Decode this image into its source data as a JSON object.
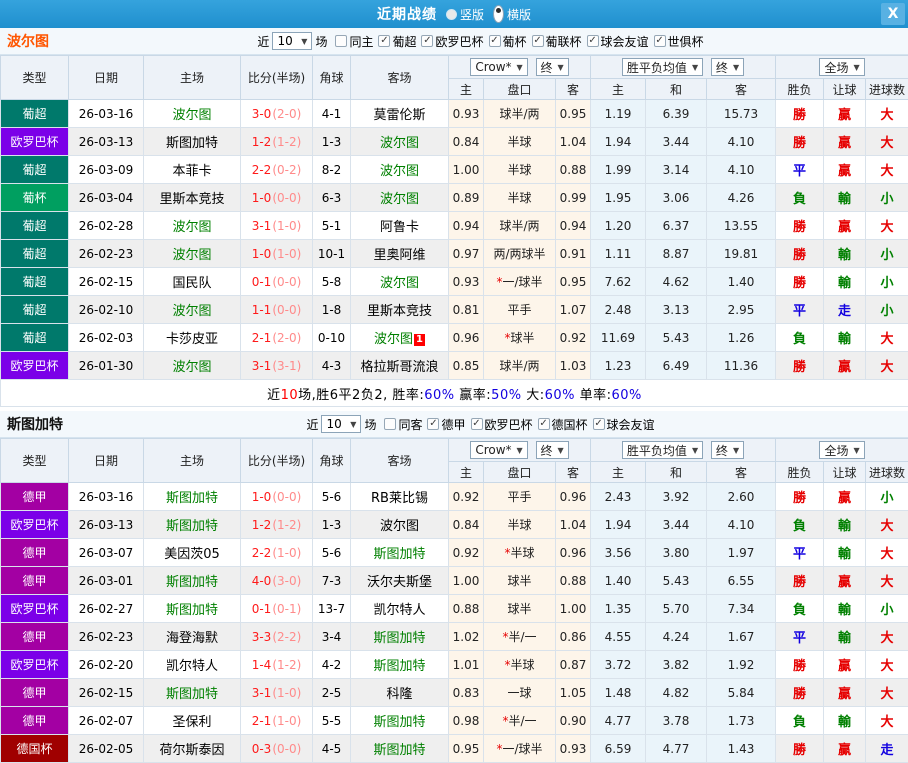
{
  "titlebar": {
    "title": "近期战绩",
    "radios": [
      {
        "label": "竖版",
        "selected": false
      },
      {
        "label": "横版",
        "selected": true
      }
    ],
    "close_label": "X"
  },
  "icons": {
    "dropdown_arrow": "▼",
    "check": "✓"
  },
  "filter_labels": {
    "near": "近",
    "games_suffix": "场"
  },
  "header": {
    "cols": [
      "类型",
      "日期",
      "主场",
      "比分(半场)",
      "角球",
      "客场"
    ],
    "odds_select": "Crow*",
    "final_select": "终",
    "avg_select": "胜平负均值",
    "avg_final_select": "终",
    "scope_select": "全场",
    "odds_sub": [
      "主",
      "盘口",
      "客"
    ],
    "avg_sub": [
      "主",
      "和",
      "客"
    ],
    "result_sub": [
      "胜负",
      "让球",
      "进球数"
    ]
  },
  "type_colors": {
    "葡超": "#00796B",
    "欧罗巴杯": "#7B00E8",
    "葡杯": "#009F60",
    "德甲": "#A300A3",
    "德国杯": "#A00000"
  },
  "result_colors": {
    "勝": "r",
    "贏": "r",
    "大": "r",
    "平": "b",
    "走": "b",
    "負": "g",
    "輸": "g",
    "小": "g"
  },
  "accent_colors": {
    "titlebar_blue": "#2E9AD5",
    "tracked_team_green": "#008000",
    "score_red": "#FF1A1A",
    "half_score_pink": "#FF8A8A",
    "odds_bg_cream": "#FDF5EA",
    "avg_bg_blue": "#EAF4FA"
  },
  "sections": [
    {
      "team": "波尔图",
      "team_color": "#FF5500",
      "filter": {
        "count": "10",
        "same_label": "同主",
        "same_checked": false,
        "leagues": [
          "葡超",
          "欧罗巴杯",
          "葡杯",
          "葡联杯",
          "球会友谊",
          "世俱杯"
        ]
      },
      "rows": [
        {
          "type": "葡超",
          "date": "26-03-16",
          "home": "波尔图",
          "score": "3-0",
          "half": "(2-0)",
          "corner": "4-1",
          "away": "莫雷伦斯",
          "oh": "0.93",
          "star": "",
          "handicap": "球半/两",
          "oa": "0.95",
          "ah": "1.19",
          "ad": "6.39",
          "aa": "15.73",
          "r1": "勝",
          "r2": "贏",
          "r3": "大"
        },
        {
          "type": "欧罗巴杯",
          "date": "26-03-13",
          "home": "斯图加特",
          "score": "1-2",
          "half": "(1-2)",
          "corner": "1-3",
          "away": "波尔图",
          "oh": "0.84",
          "star": "",
          "handicap": "半球",
          "oa": "1.04",
          "ah": "1.94",
          "ad": "3.44",
          "aa": "4.10",
          "r1": "勝",
          "r2": "贏",
          "r3": "大"
        },
        {
          "type": "葡超",
          "date": "26-03-09",
          "home": "本菲卡",
          "score": "2-2",
          "half": "(0-2)",
          "corner": "8-2",
          "away": "波尔图",
          "oh": "1.00",
          "star": "",
          "handicap": "半球",
          "oa": "0.88",
          "ah": "1.99",
          "ad": "3.14",
          "aa": "4.10",
          "r1": "平",
          "r2": "贏",
          "r3": "大"
        },
        {
          "type": "葡杯",
          "date": "26-03-04",
          "home": "里斯本竞技",
          "score": "1-0",
          "half": "(0-0)",
          "corner": "6-3",
          "away": "波尔图",
          "oh": "0.89",
          "star": "",
          "handicap": "半球",
          "oa": "0.99",
          "ah": "1.95",
          "ad": "3.06",
          "aa": "4.26",
          "r1": "負",
          "r2": "輸",
          "r3": "小"
        },
        {
          "type": "葡超",
          "date": "26-02-28",
          "home": "波尔图",
          "score": "3-1",
          "half": "(1-0)",
          "corner": "5-1",
          "away": "阿鲁卡",
          "oh": "0.94",
          "star": "",
          "handicap": "球半/两",
          "oa": "0.94",
          "ah": "1.20",
          "ad": "6.37",
          "aa": "13.55",
          "r1": "勝",
          "r2": "贏",
          "r3": "大"
        },
        {
          "type": "葡超",
          "date": "26-02-23",
          "home": "波尔图",
          "score": "1-0",
          "half": "(1-0)",
          "corner": "10-1",
          "away": "里奥阿维",
          "oh": "0.97",
          "star": "",
          "handicap": "两/两球半",
          "oa": "0.91",
          "ah": "1.11",
          "ad": "8.87",
          "aa": "19.81",
          "r1": "勝",
          "r2": "輸",
          "r3": "小"
        },
        {
          "type": "葡超",
          "date": "26-02-15",
          "home": "国民队",
          "score": "0-1",
          "half": "(0-0)",
          "corner": "5-8",
          "away": "波尔图",
          "oh": "0.93",
          "star": "*",
          "handicap": "一/球半",
          "oa": "0.95",
          "ah": "7.62",
          "ad": "4.62",
          "aa": "1.40",
          "r1": "勝",
          "r2": "輸",
          "r3": "小"
        },
        {
          "type": "葡超",
          "date": "26-02-10",
          "home": "波尔图",
          "score": "1-1",
          "half": "(0-0)",
          "corner": "1-8",
          "away": "里斯本竞技",
          "oh": "0.81",
          "star": "",
          "handicap": "平手",
          "oa": "1.07",
          "ah": "2.48",
          "ad": "3.13",
          "aa": "2.95",
          "r1": "平",
          "r2": "走",
          "r3": "小"
        },
        {
          "type": "葡超",
          "date": "26-02-03",
          "home": "卡莎皮亚",
          "score": "2-1",
          "half": "(2-0)",
          "corner": "0-10",
          "away": "波尔图",
          "away_badge": "1",
          "oh": "0.96",
          "star": "*",
          "handicap": "球半",
          "oa": "0.92",
          "ah": "11.69",
          "ad": "5.43",
          "aa": "1.26",
          "r1": "負",
          "r2": "輸",
          "r3": "大"
        },
        {
          "type": "欧罗巴杯",
          "date": "26-01-30",
          "home": "波尔图",
          "score": "3-1",
          "half": "(3-1)",
          "corner": "4-3",
          "away": "格拉斯哥流浪",
          "oh": "0.85",
          "star": "",
          "handicap": "球半/两",
          "oa": "1.03",
          "ah": "1.23",
          "ad": "6.49",
          "aa": "11.36",
          "r1": "勝",
          "r2": "贏",
          "r3": "大"
        }
      ],
      "summary": [
        {
          "t": "近"
        },
        {
          "t": "10",
          "c": "r"
        },
        {
          "t": "场,胜6平2负2, 胜率:"
        },
        {
          "t": "60%",
          "c": "b"
        },
        {
          "t": " 赢率:"
        },
        {
          "t": "50%",
          "c": "b"
        },
        {
          "t": " 大:"
        },
        {
          "t": "60%",
          "c": "b"
        },
        {
          "t": " 单率:"
        },
        {
          "t": "60%",
          "c": "b"
        }
      ]
    },
    {
      "team": "斯图加特",
      "team_color": "#111111",
      "filter": {
        "count": "10",
        "same_label": "同客",
        "same_checked": false,
        "leagues": [
          "德甲",
          "欧罗巴杯",
          "德国杯",
          "球会友谊"
        ]
      },
      "rows": [
        {
          "type": "德甲",
          "date": "26-03-16",
          "home": "斯图加特",
          "score": "1-0",
          "half": "(0-0)",
          "corner": "5-6",
          "away": "RB莱比锡",
          "oh": "0.92",
          "star": "",
          "handicap": "平手",
          "oa": "0.96",
          "ah": "2.43",
          "ad": "3.92",
          "aa": "2.60",
          "r1": "勝",
          "r2": "贏",
          "r3": "小"
        },
        {
          "type": "欧罗巴杯",
          "date": "26-03-13",
          "home": "斯图加特",
          "score": "1-2",
          "half": "(1-2)",
          "corner": "1-3",
          "away": "波尔图",
          "oh": "0.84",
          "star": "",
          "handicap": "半球",
          "oa": "1.04",
          "ah": "1.94",
          "ad": "3.44",
          "aa": "4.10",
          "r1": "負",
          "r2": "輸",
          "r3": "大"
        },
        {
          "type": "德甲",
          "date": "26-03-07",
          "home": "美因茨05",
          "score": "2-2",
          "half": "(1-0)",
          "corner": "5-6",
          "away": "斯图加特",
          "oh": "0.92",
          "star": "*",
          "handicap": "半球",
          "oa": "0.96",
          "ah": "3.56",
          "ad": "3.80",
          "aa": "1.97",
          "r1": "平",
          "r2": "輸",
          "r3": "大"
        },
        {
          "type": "德甲",
          "date": "26-03-01",
          "home": "斯图加特",
          "score": "4-0",
          "half": "(3-0)",
          "corner": "7-3",
          "away": "沃尔夫斯堡",
          "oh": "1.00",
          "star": "",
          "handicap": "球半",
          "oa": "0.88",
          "ah": "1.40",
          "ad": "5.43",
          "aa": "6.55",
          "r1": "勝",
          "r2": "贏",
          "r3": "大"
        },
        {
          "type": "欧罗巴杯",
          "date": "26-02-27",
          "home": "斯图加特",
          "score": "0-1",
          "half": "(0-1)",
          "corner": "13-7",
          "away": "凯尔特人",
          "oh": "0.88",
          "star": "",
          "handicap": "球半",
          "oa": "1.00",
          "ah": "1.35",
          "ad": "5.70",
          "aa": "7.34",
          "r1": "負",
          "r2": "輸",
          "r3": "小"
        },
        {
          "type": "德甲",
          "date": "26-02-23",
          "home": "海登海默",
          "score": "3-3",
          "half": "(2-2)",
          "corner": "3-4",
          "away": "斯图加特",
          "oh": "1.02",
          "star": "*",
          "handicap": "半/一",
          "oa": "0.86",
          "ah": "4.55",
          "ad": "4.24",
          "aa": "1.67",
          "r1": "平",
          "r2": "輸",
          "r3": "大"
        },
        {
          "type": "欧罗巴杯",
          "date": "26-02-20",
          "home": "凯尔特人",
          "score": "1-4",
          "half": "(1-2)",
          "corner": "4-2",
          "away": "斯图加特",
          "oh": "1.01",
          "star": "*",
          "handicap": "半球",
          "oa": "0.87",
          "ah": "3.72",
          "ad": "3.82",
          "aa": "1.92",
          "r1": "勝",
          "r2": "贏",
          "r3": "大"
        },
        {
          "type": "德甲",
          "date": "26-02-15",
          "home": "斯图加特",
          "score": "3-1",
          "half": "(1-0)",
          "corner": "2-5",
          "away": "科隆",
          "oh": "0.83",
          "star": "",
          "handicap": "一球",
          "oa": "1.05",
          "ah": "1.48",
          "ad": "4.82",
          "aa": "5.84",
          "r1": "勝",
          "r2": "贏",
          "r3": "大"
        },
        {
          "type": "德甲",
          "date": "26-02-07",
          "home": "圣保利",
          "score": "2-1",
          "half": "(1-0)",
          "corner": "5-5",
          "away": "斯图加特",
          "oh": "0.98",
          "star": "*",
          "handicap": "半/一",
          "oa": "0.90",
          "ah": "4.77",
          "ad": "3.78",
          "aa": "1.73",
          "r1": "負",
          "r2": "輸",
          "r3": "大"
        },
        {
          "type": "德国杯",
          "date": "26-02-05",
          "home": "荷尔斯泰因",
          "score": "0-3",
          "half": "(0-0)",
          "corner": "4-5",
          "away": "斯图加特",
          "oh": "0.95",
          "star": "*",
          "handicap": "一/球半",
          "oa": "0.93",
          "ah": "6.59",
          "ad": "4.77",
          "aa": "1.43",
          "r1": "勝",
          "r2": "贏",
          "r3": "走"
        }
      ]
    }
  ]
}
